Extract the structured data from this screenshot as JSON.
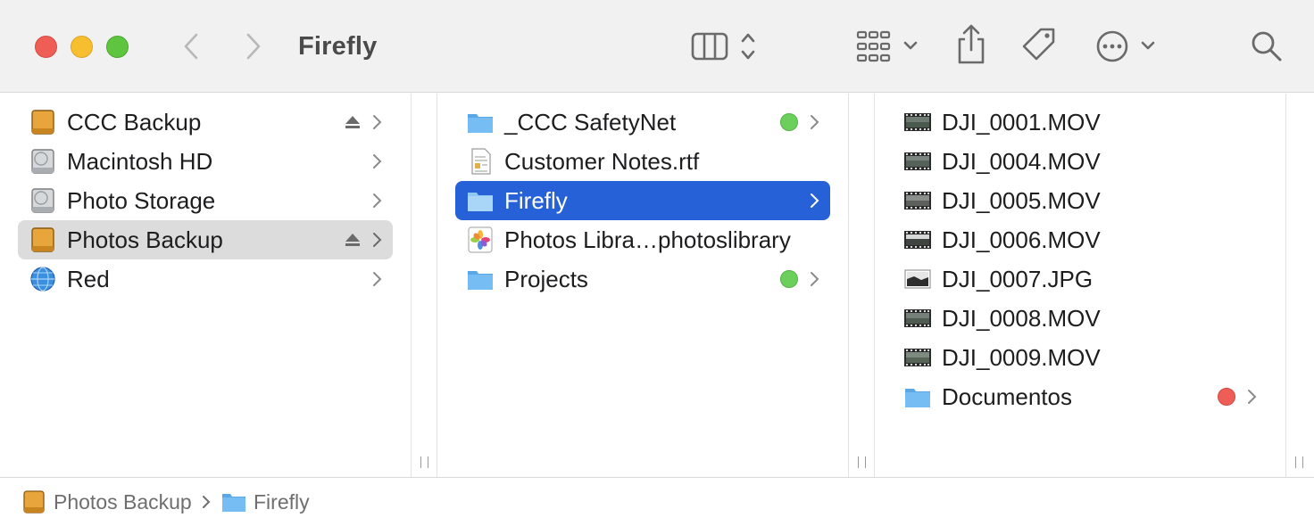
{
  "window": {
    "title": "Firefly"
  },
  "toolbar": {
    "icons": [
      "back-chevron-icon",
      "forward-chevron-icon",
      "column-view-icon",
      "group-grid-icon",
      "share-icon",
      "tag-icon",
      "more-ellipsis-icon",
      "search-icon"
    ]
  },
  "colors": {
    "selection_blue": "#2761d8",
    "selection_gray": "#dcdcdc",
    "tag_green": "#6bcf5c",
    "tag_red": "#ee5e57",
    "folder_blue": "#6ab5ee"
  },
  "columns": {
    "volumes": [
      {
        "label": "CCC Backup",
        "icon": "external-drive-icon",
        "eject": true
      },
      {
        "label": "Macintosh HD",
        "icon": "internal-drive-icon",
        "eject": false
      },
      {
        "label": "Photo Storage",
        "icon": "internal-drive-icon",
        "eject": false
      },
      {
        "label": "Photos Backup",
        "icon": "external-drive-icon",
        "eject": true,
        "selected": true
      },
      {
        "label": "Red",
        "icon": "network-globe-icon",
        "eject": false
      }
    ],
    "photos_backup": [
      {
        "label": "_CCC SafetyNet",
        "icon": "folder-icon",
        "tag": "green",
        "has_children": true
      },
      {
        "label": "Customer Notes.rtf",
        "icon": "rtf-document-icon",
        "has_children": false
      },
      {
        "label": "Firefly",
        "icon": "folder-icon",
        "has_children": true,
        "selected": true
      },
      {
        "label": "Photos Libra…photoslibrary",
        "icon": "photos-library-icon",
        "has_children": false
      },
      {
        "label": "Projects",
        "icon": "folder-icon",
        "tag": "green",
        "has_children": true
      }
    ],
    "firefly": [
      {
        "label": "DJI_0001.MOV",
        "icon": "video-thumbnail-icon"
      },
      {
        "label": "DJI_0004.MOV",
        "icon": "video-thumbnail-icon"
      },
      {
        "label": "DJI_0005.MOV",
        "icon": "video-thumbnail-icon"
      },
      {
        "label": "DJI_0006.MOV",
        "icon": "video-thumbnail-icon"
      },
      {
        "label": "DJI_0007.JPG",
        "icon": "image-thumbnail-icon"
      },
      {
        "label": "DJI_0008.MOV",
        "icon": "video-thumbnail-icon"
      },
      {
        "label": "DJI_0009.MOV",
        "icon": "video-thumbnail-icon"
      },
      {
        "label": "Documentos",
        "icon": "folder-icon",
        "tag": "red",
        "has_children": true
      }
    ]
  },
  "pathbar": {
    "crumbs": [
      "Photos Backup",
      "Firefly"
    ]
  }
}
